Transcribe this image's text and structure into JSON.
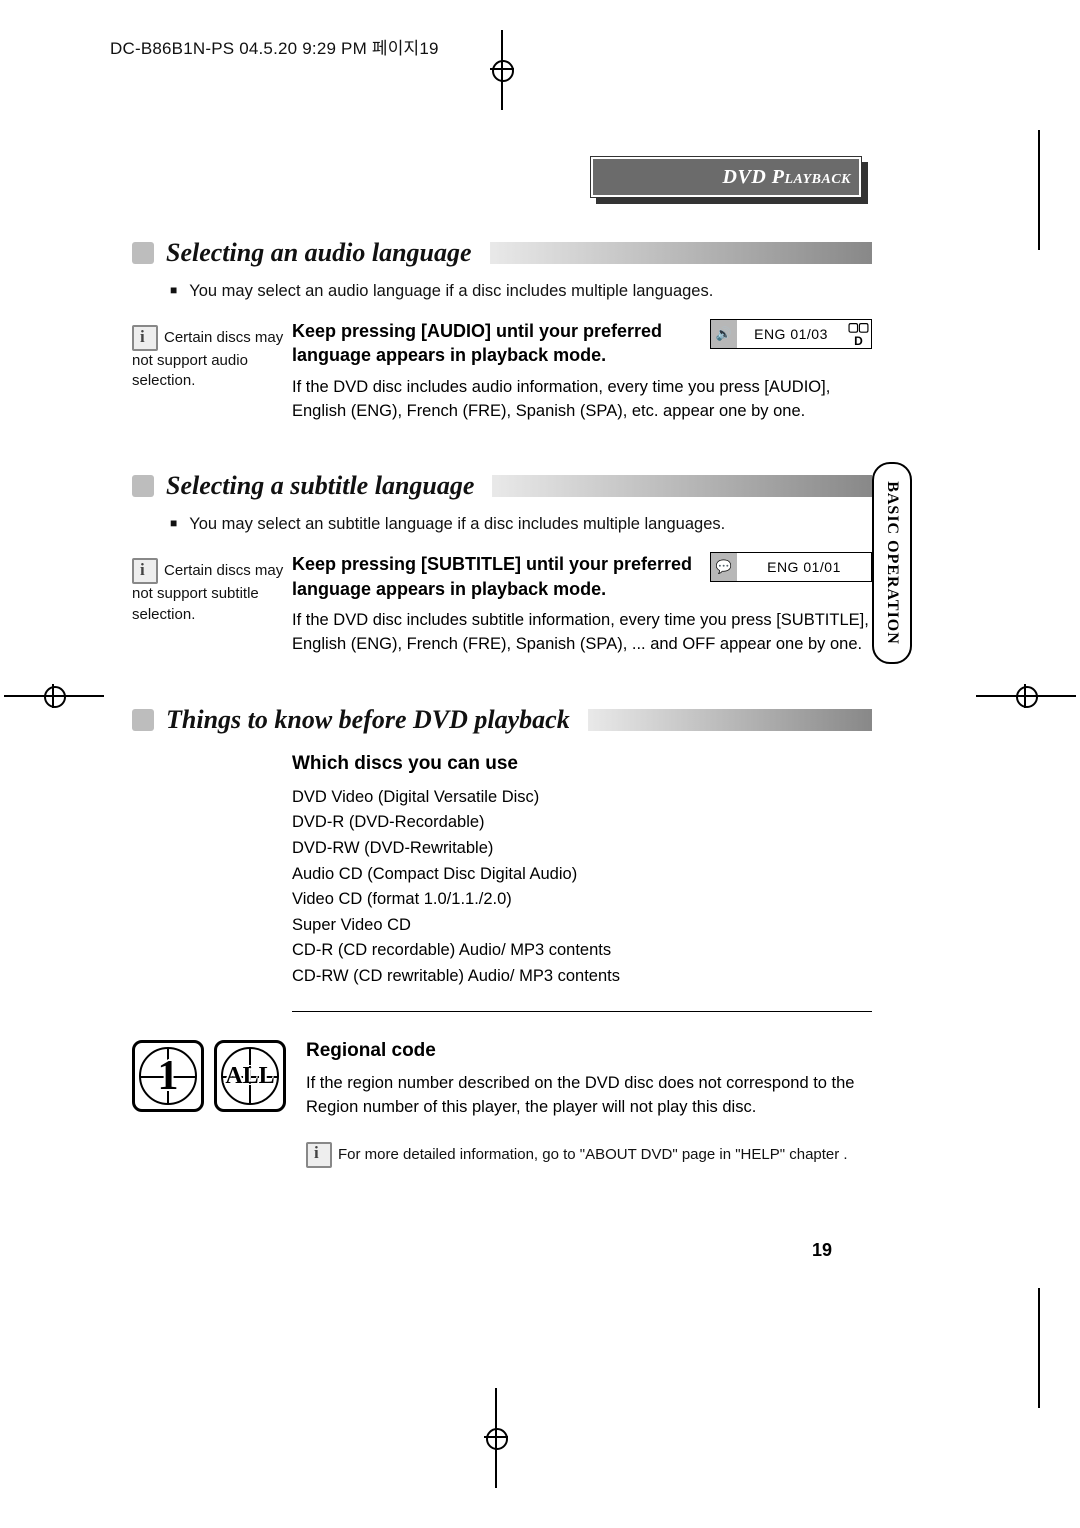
{
  "header_line": "DC-B86B1N-PS  04.5.20 9:29 PM  페이지19",
  "section_header": "DVD Playback",
  "side_tab": "BASIC OPERATION",
  "page_number": "19",
  "sec1": {
    "title": "Selecting an audio language",
    "bullet": "You may select an audio language if a disc includes multiple languages.",
    "sidenote": "Certain discs may not support audio selection.",
    "lead": "Keep pressing [AUDIO] until your preferred language appears in playback mode.",
    "para": "If the DVD disc includes audio information, every time you press [AUDIO], English (ENG), French (FRE), Spanish (SPA), etc. appear one by one.",
    "osd_text": "ENG 01/03",
    "osd_dd": "▢▢ D"
  },
  "sec2": {
    "title": "Selecting a subtitle language",
    "bullet": "You may select an subtitle language if a disc includes multiple languages.",
    "sidenote": "Certain discs may not support subtitle selection.",
    "lead": "Keep pressing [SUBTITLE] until your preferred language appears in playback mode.",
    "para": "If the DVD disc includes subtitle information, every time you press [SUBTITLE], English (ENG), French (FRE), Spanish (SPA), ... and OFF appear one by one.",
    "osd_text": "ENG 01/01"
  },
  "sec3": {
    "title": "Things to know before DVD playback",
    "sub1_title": "Which discs you can use",
    "list": [
      "DVD Video (Digital Versatile Disc)",
      "DVD-R (DVD-Recordable)",
      "DVD-RW (DVD-Rewritable)",
      "Audio CD (Compact Disc Digital Audio)",
      "Video CD (format 1.0/1.1./2.0)",
      "Super Video CD",
      "CD-R (CD recordable) Audio/ MP3 contents",
      "CD-RW (CD rewritable) Audio/ MP3 contents"
    ],
    "sub2_title": "Regional code",
    "region_para": "If the region number described on the DVD disc does not correspond to the Region number of this player, the player will not play this disc.",
    "region_1": "1",
    "region_all": "ALL",
    "footnote": "For more detailed information, go to \"ABOUT DVD\" page in \"HELP\" chapter ."
  }
}
